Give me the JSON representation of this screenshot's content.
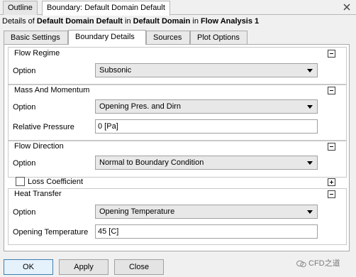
{
  "doc_tabs": [
    {
      "label": "Outline",
      "active": false
    },
    {
      "label": "Boundary: Default Domain Default",
      "active": true
    }
  ],
  "details": {
    "prefix": "Details of ",
    "object": "Default Domain Default",
    "in1": " in ",
    "domain": "Default Domain",
    "in2": " in ",
    "analysis": "Flow Analysis 1"
  },
  "sub_tabs": [
    {
      "label": "Basic Settings",
      "active": false
    },
    {
      "label": "Boundary Details",
      "active": true
    },
    {
      "label": "Sources",
      "active": false
    },
    {
      "label": "Plot Options",
      "active": false
    }
  ],
  "flow_regime": {
    "title": "Flow Regime",
    "option_label": "Option",
    "option_value": "Subsonic"
  },
  "mass_momentum": {
    "title": "Mass And Momentum",
    "option_label": "Option",
    "option_value": "Opening Pres. and Dirn",
    "rel_pressure_label": "Relative Pressure",
    "rel_pressure_value": "0 [Pa]"
  },
  "flow_direction": {
    "title": "Flow Direction",
    "option_label": "Option",
    "option_value": "Normal to Boundary Condition"
  },
  "loss_coefficient": {
    "label": "Loss Coefficient",
    "checked": false
  },
  "heat_transfer": {
    "title": "Heat Transfer",
    "option_label": "Option",
    "option_value": "Opening Temperature",
    "opening_temp_label": "Opening Temperature",
    "opening_temp_value": "45 [C]"
  },
  "buttons": {
    "ok": "OK",
    "apply": "Apply",
    "close": "Close"
  },
  "watermark": "CFD之道",
  "colors": {
    "window_bg": "#f0f0f0",
    "panel_bg": "#ffffff",
    "ok_border": "#3c7fb1"
  }
}
